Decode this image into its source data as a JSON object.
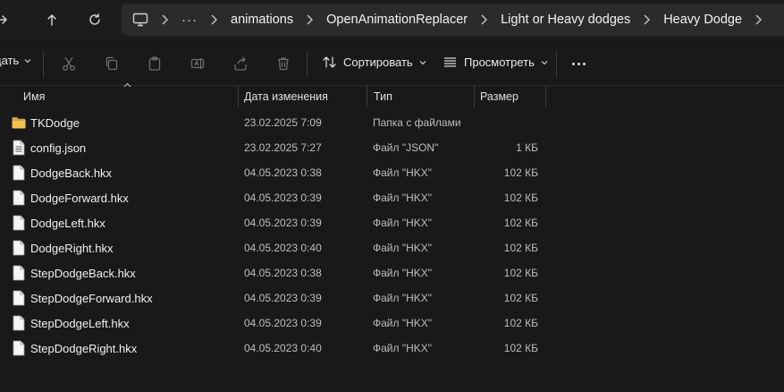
{
  "breadcrumb": {
    "overflow": "···",
    "segments": [
      "animations",
      "OpenAnimationReplacer",
      "Light or Heavy dodges",
      "Heavy Dodge"
    ]
  },
  "toolbar": {
    "new_label": "дать",
    "sort_label": "Сортировать",
    "view_label": "Просмотреть"
  },
  "columns": {
    "name": "Имя",
    "date": "Дата изменения",
    "type": "Тип",
    "size": "Размер"
  },
  "files": [
    {
      "name": "TKDodge",
      "date": "23.02.2025 7:09",
      "type": "Папка с файлами",
      "size": "",
      "icon": "folder-icon"
    },
    {
      "name": "config.json",
      "date": "23.02.2025 7:27",
      "type": "Файл \"JSON\"",
      "size": "1 КБ",
      "icon": "text-file-icon"
    },
    {
      "name": "DodgeBack.hkx",
      "date": "04.05.2023 0:38",
      "type": "Файл \"HKX\"",
      "size": "102 КБ",
      "icon": "file-icon"
    },
    {
      "name": "DodgeForward.hkx",
      "date": "04.05.2023 0:39",
      "type": "Файл \"HKX\"",
      "size": "102 КБ",
      "icon": "file-icon"
    },
    {
      "name": "DodgeLeft.hkx",
      "date": "04.05.2023 0:39",
      "type": "Файл \"HKX\"",
      "size": "102 КБ",
      "icon": "file-icon"
    },
    {
      "name": "DodgeRight.hkx",
      "date": "04.05.2023 0:40",
      "type": "Файл \"HKX\"",
      "size": "102 КБ",
      "icon": "file-icon"
    },
    {
      "name": "StepDodgeBack.hkx",
      "date": "04.05.2023 0:38",
      "type": "Файл \"HKX\"",
      "size": "102 КБ",
      "icon": "file-icon"
    },
    {
      "name": "StepDodgeForward.hkx",
      "date": "04.05.2023 0:39",
      "type": "Файл \"HKX\"",
      "size": "102 КБ",
      "icon": "file-icon"
    },
    {
      "name": "StepDodgeLeft.hkx",
      "date": "04.05.2023 0:39",
      "type": "Файл \"HKX\"",
      "size": "102 КБ",
      "icon": "file-icon"
    },
    {
      "name": "StepDodgeRight.hkx",
      "date": "04.05.2023 0:40",
      "type": "Файл \"HKX\"",
      "size": "102 КБ",
      "icon": "file-icon"
    }
  ],
  "colors": {
    "background": "#191919",
    "address_bar": "#2b2b2b",
    "folder": "#f2c14e",
    "text": "#f0f0f0",
    "muted_text": "#bdbdbd"
  }
}
